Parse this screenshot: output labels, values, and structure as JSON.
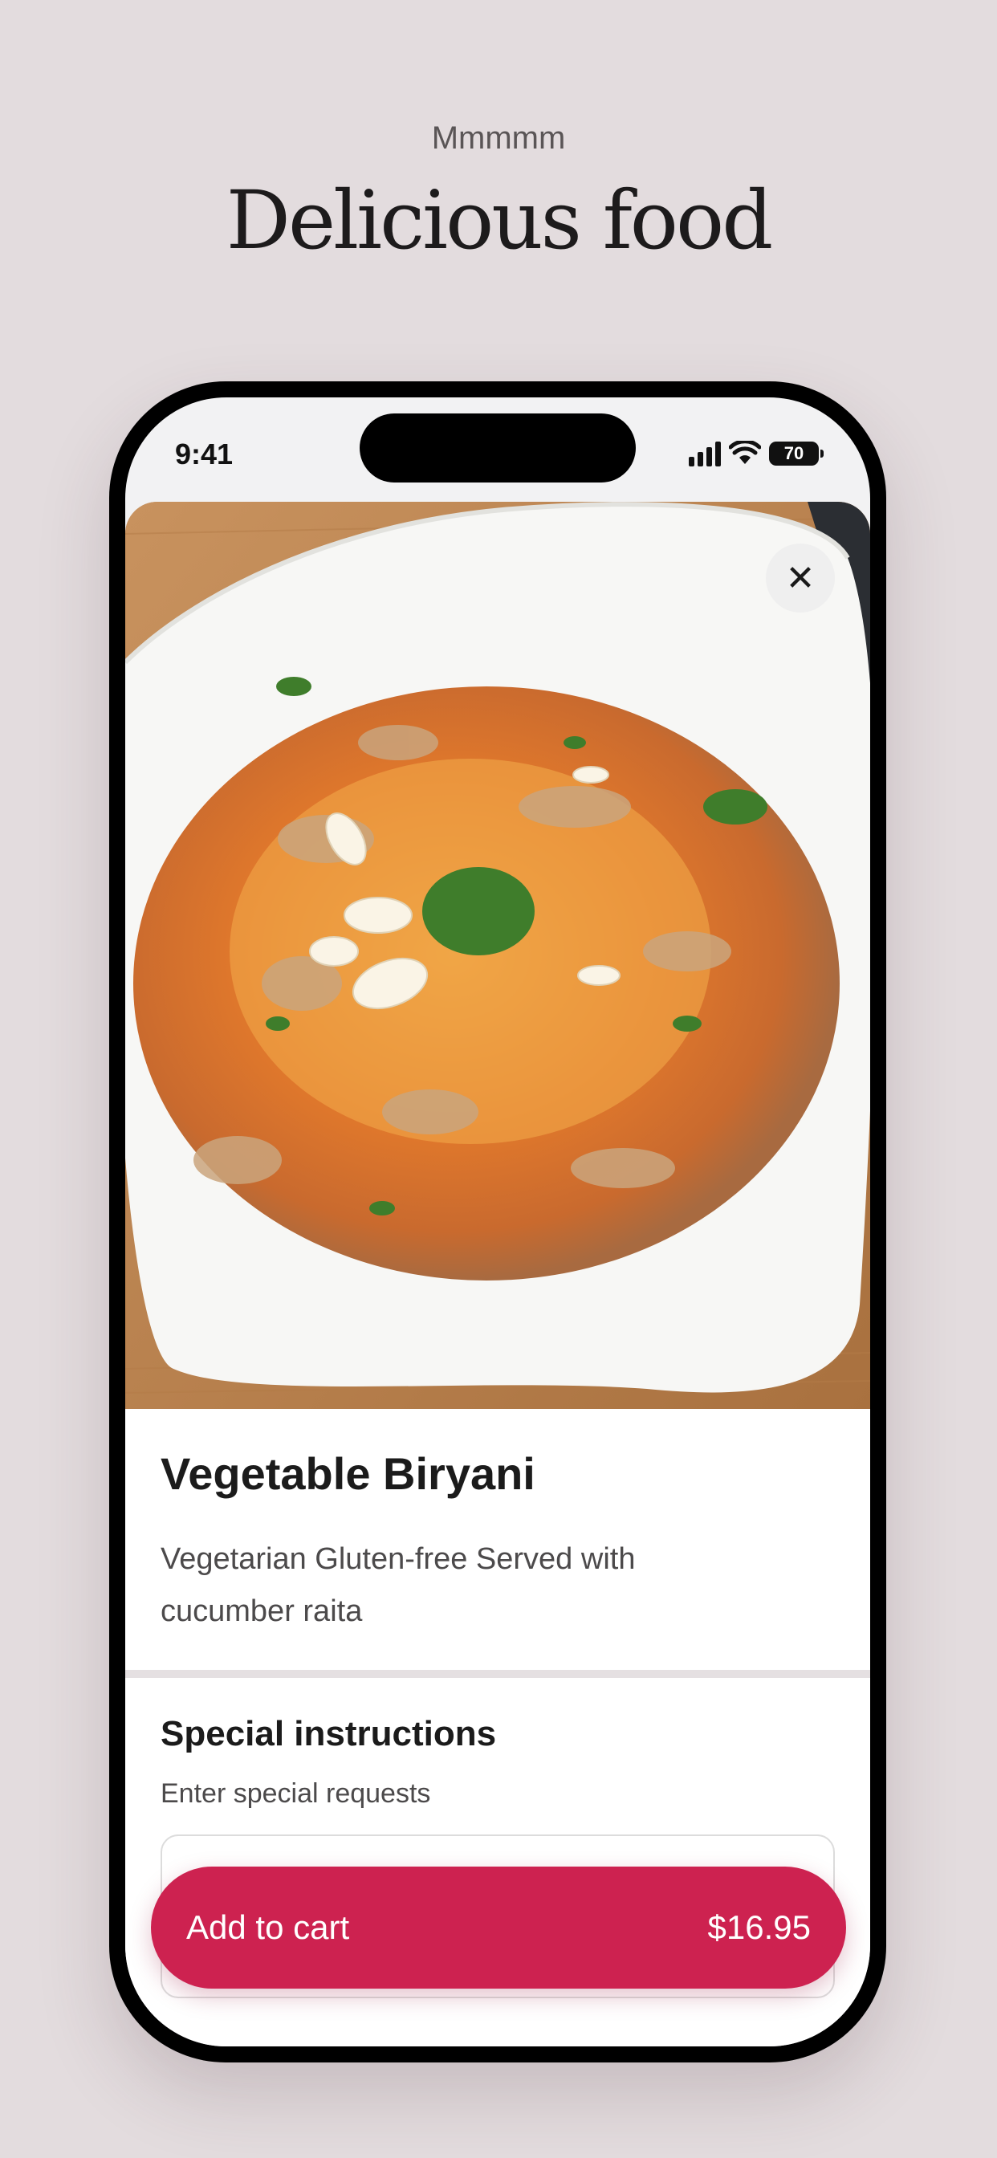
{
  "promo": {
    "eyebrow": "Mmmmm",
    "title": "Delicious food"
  },
  "status_bar": {
    "time": "9:41",
    "battery": "70",
    "icons": [
      "signal-icon",
      "wifi-icon",
      "battery-icon"
    ]
  },
  "item": {
    "image_alt": "Vegetable biryani on a white plate",
    "name": "Vegetable Biryani",
    "description": "Vegetarian Gluten-free Served with cucumber raita"
  },
  "special_instructions": {
    "title": "Special instructions",
    "subtitle": "Enter special requests"
  },
  "cart_button": {
    "label": "Add to cart",
    "price": "$16.95"
  },
  "colors": {
    "background": "#e3dcde",
    "accent": "#cd2250",
    "text": "#1b1b1b"
  }
}
